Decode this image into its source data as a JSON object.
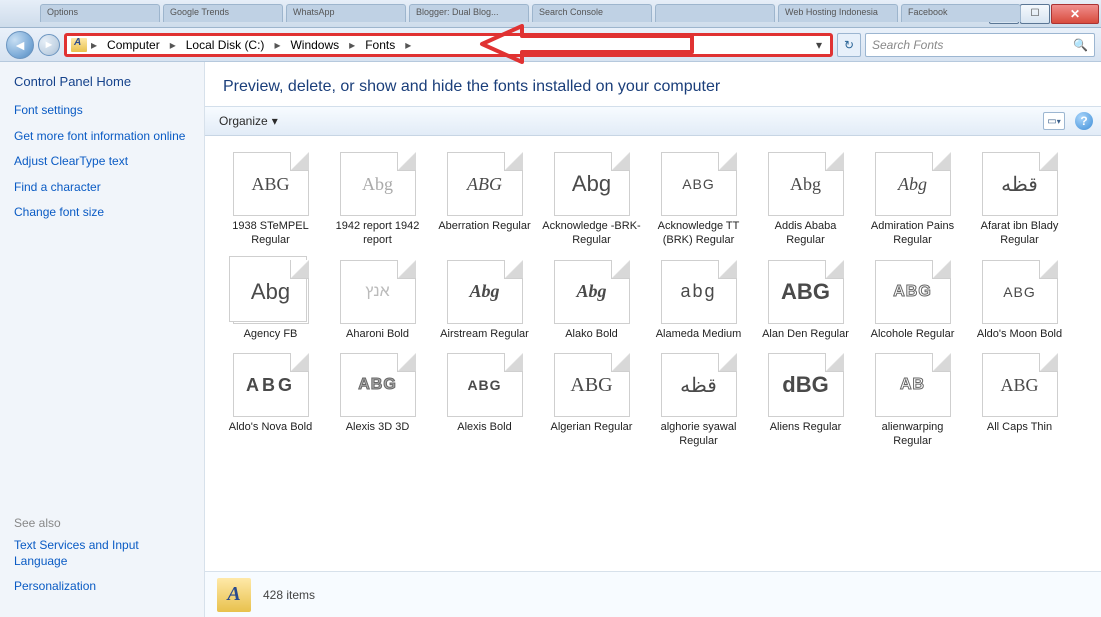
{
  "window": {
    "tabs": [
      "Options",
      "Google Trends",
      "WhatsApp",
      "Blogger: Dual Blog...",
      "Search Console",
      "",
      "Web Hosting Indonesia",
      "Facebook"
    ],
    "buttons": {
      "min": "—",
      "max": "☐",
      "close": "✕"
    }
  },
  "address": {
    "crumbs": [
      "Computer",
      "Local Disk (C:)",
      "Windows",
      "Fonts"
    ],
    "search_placeholder": "Search Fonts"
  },
  "sidebar": {
    "home": "Control Panel Home",
    "links": [
      "Font settings",
      "Get more font information online",
      "Adjust ClearType text",
      "Find a character",
      "Change font size"
    ],
    "see_also_label": "See also",
    "see_also": [
      "Text Services and Input Language",
      "Personalization"
    ]
  },
  "main": {
    "heading": "Preview, delete, or show and hide the fonts installed on your computer",
    "organize": "Organize",
    "status_count": "428 items"
  },
  "fonts": [
    [
      {
        "label": "1938 STeMPEL Regular",
        "preview": "ABG",
        "cls": "p-serif"
      },
      {
        "label": "1942 report 1942 report",
        "preview": "Abg",
        "cls": "p-serif p-grey"
      },
      {
        "label": "Aberration Regular",
        "preview": "ABG",
        "cls": "p-italic"
      },
      {
        "label": "Acknowledge -BRK- Regular",
        "preview": "Abg",
        "cls": "p-sans"
      },
      {
        "label": "Acknowledge TT (BRK) Regular",
        "preview": "ABG",
        "cls": "p-block"
      },
      {
        "label": "Addis Ababa Regular",
        "preview": "Abg",
        "cls": "p-hand"
      },
      {
        "label": "Admiration Pains Regular",
        "preview": "Abg",
        "cls": "p-script"
      },
      {
        "label": "Afarat ibn Blady Regular",
        "preview": "قظه",
        "cls": "p-arabic"
      }
    ],
    [
      {
        "label": "Agency FB",
        "preview": "Abg",
        "cls": "p-sans",
        "stack": true
      },
      {
        "label": "Aharoni Bold",
        "preview": "אנץ",
        "cls": "p-heb"
      },
      {
        "label": "Airstream Regular",
        "preview": "Abg",
        "cls": "p-italic",
        "bold": true
      },
      {
        "label": "Alako Bold",
        "preview": "Abg",
        "cls": "p-italic",
        "bold": true
      },
      {
        "label": "Alameda Medium",
        "preview": "abg",
        "cls": "p-thin"
      },
      {
        "label": "Alan Den Regular",
        "preview": "ABG",
        "cls": "p-sans",
        "bold": true
      },
      {
        "label": "Alcohole Regular",
        "preview": "ABG",
        "cls": "p-outline"
      },
      {
        "label": "Aldo's Moon Bold",
        "preview": "ABG",
        "cls": "p-block"
      }
    ],
    [
      {
        "label": "Aldo's Nova Bold",
        "preview": "ABG",
        "cls": "p-wide"
      },
      {
        "label": "Alexis 3D 3D",
        "preview": "ABG",
        "cls": "p-outline p-grey"
      },
      {
        "label": "Alexis Bold",
        "preview": "ABG",
        "cls": "p-block",
        "bold": true
      },
      {
        "label": "Algerian Regular",
        "preview": "ABG",
        "cls": "p-smallcaps"
      },
      {
        "label": "alghorie syawal Regular",
        "preview": "قظه",
        "cls": "p-arabic"
      },
      {
        "label": "Aliens Regular",
        "preview": "dBG",
        "cls": "p-sans",
        "bold": true
      },
      {
        "label": "alienwarping Regular",
        "preview": "AB",
        "cls": "p-outline"
      },
      {
        "label": "All Caps Thin",
        "preview": "ABG",
        "cls": "p-hand"
      }
    ]
  ]
}
